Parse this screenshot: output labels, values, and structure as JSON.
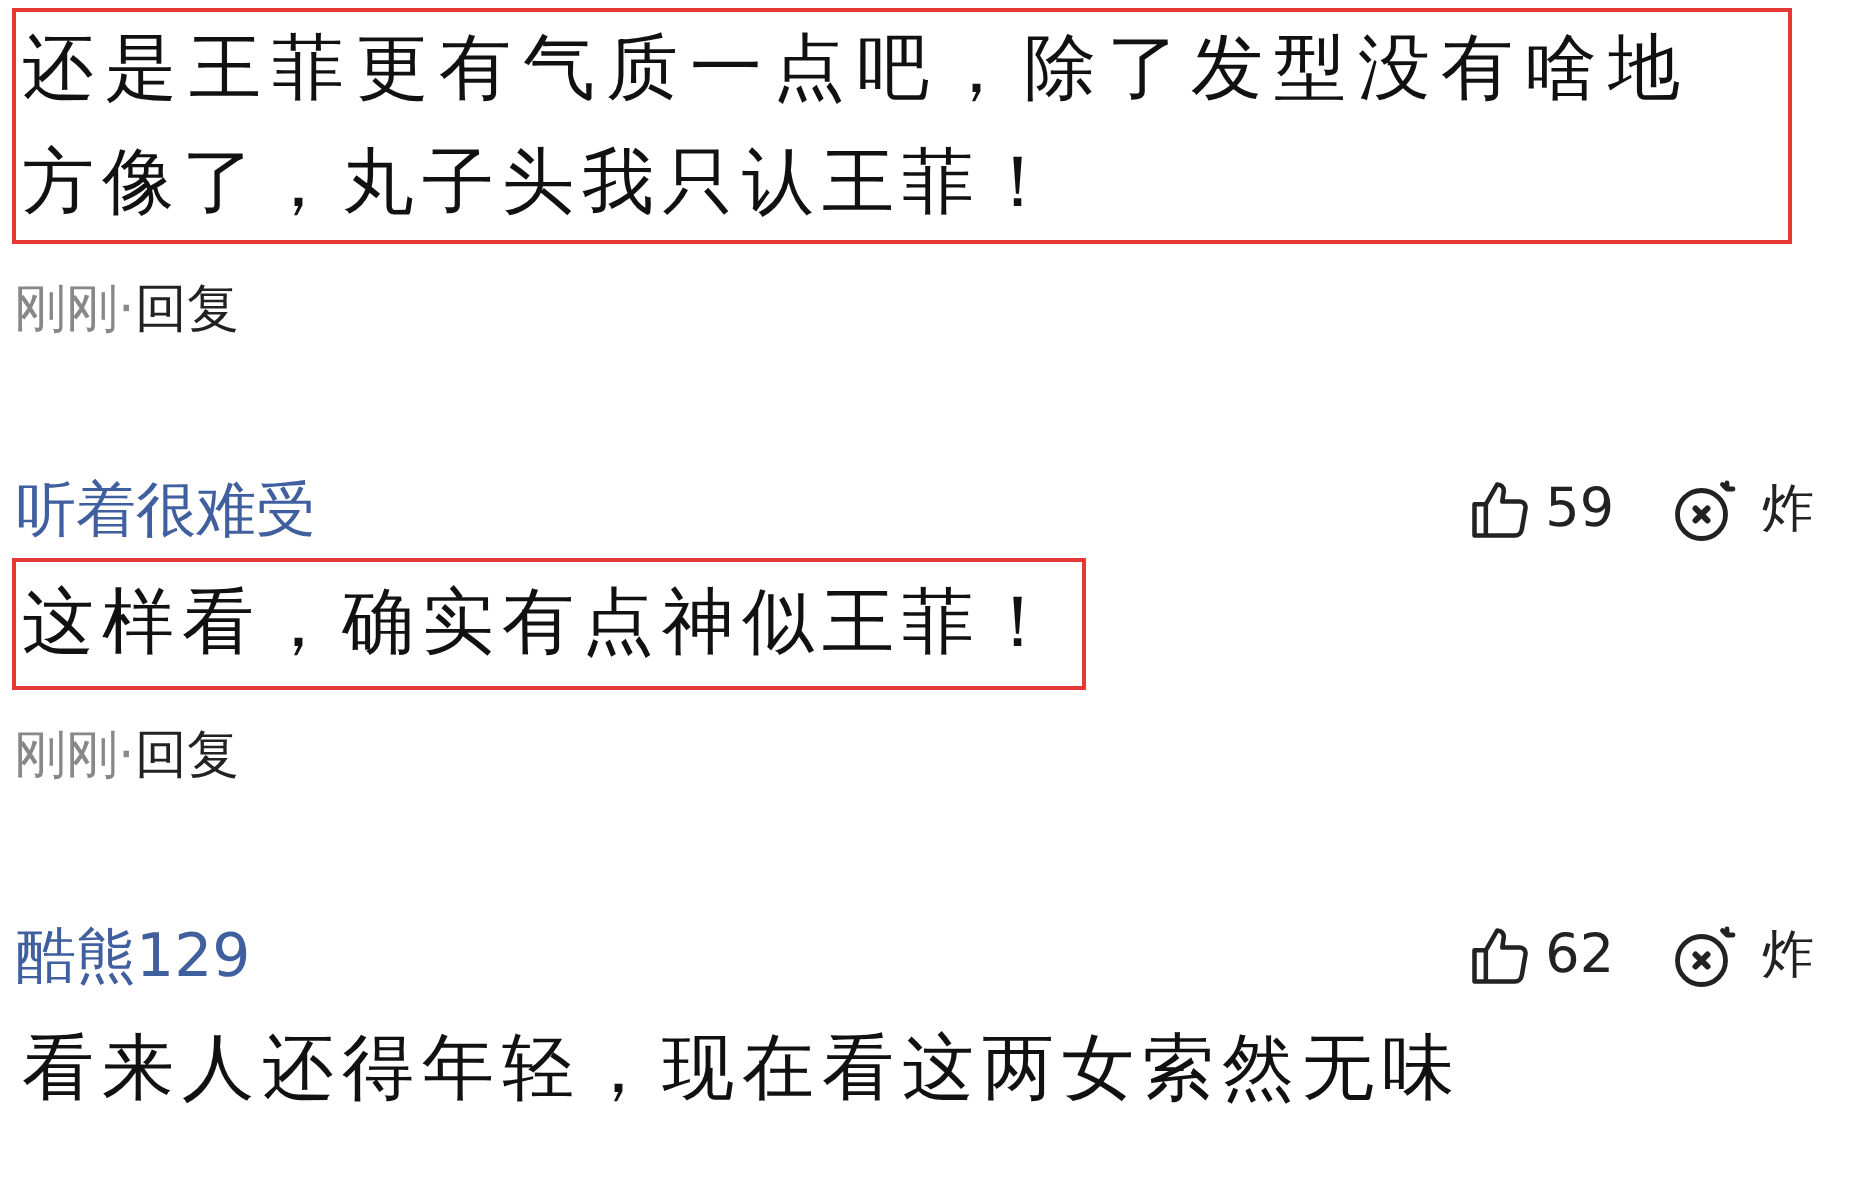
{
  "comments": [
    {
      "body": "还是王菲更有气质一点吧，除了发型没有啥地方像了，丸子头我只认王菲！",
      "highlighted": true,
      "time": "刚刚",
      "separator": "·",
      "reply": "回复"
    },
    {
      "user": "听着很难受",
      "likes": "59",
      "bomb": "炸",
      "body": "这样看，确实有点神似王菲！",
      "highlighted": true,
      "time": "刚刚",
      "separator": "·",
      "reply": "回复"
    },
    {
      "user": "酷熊129",
      "likes": "62",
      "bomb": "炸",
      "body": "看来人还得年轻，现在看这两女索然无味",
      "highlighted": false
    }
  ]
}
